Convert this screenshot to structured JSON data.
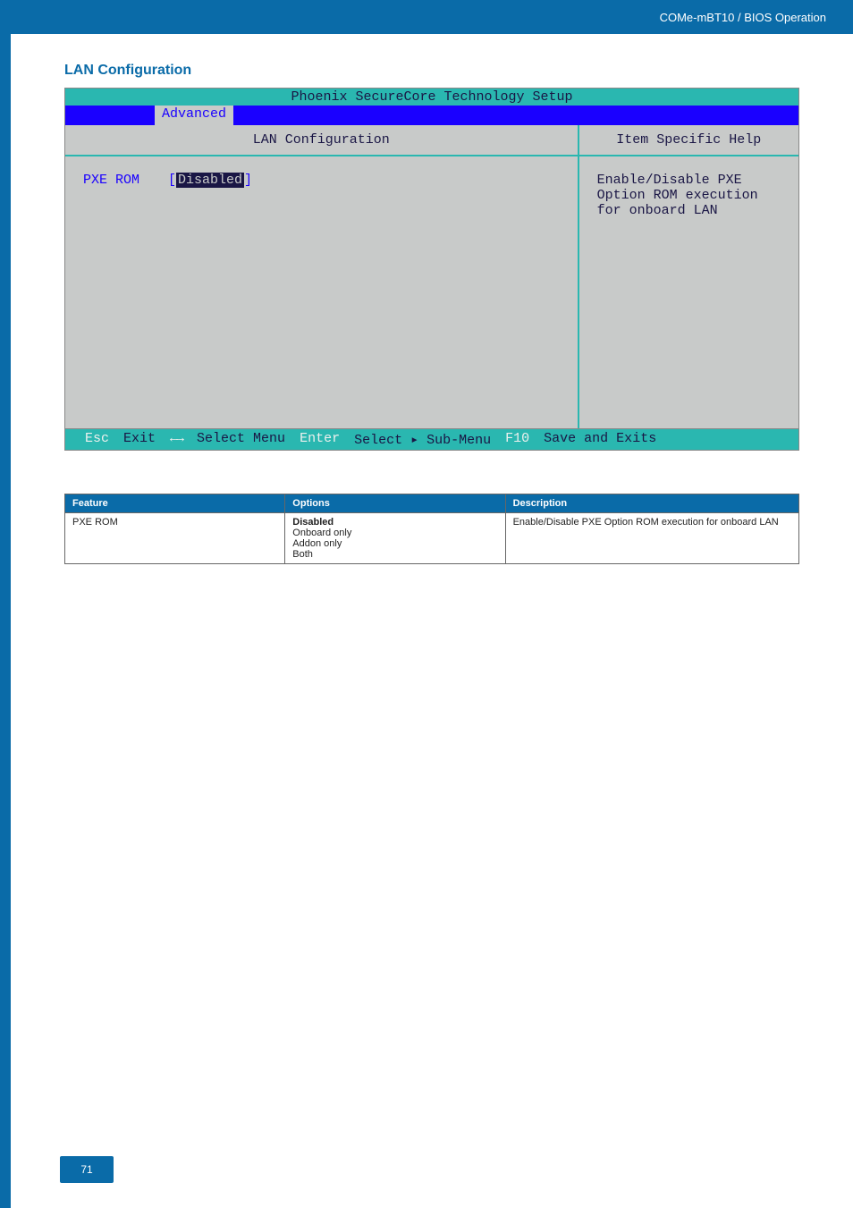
{
  "header": {
    "title_right": "COMe-mBT10 / BIOS Operation"
  },
  "section": {
    "title": "LAN Configuration"
  },
  "bios": {
    "title": "Phoenix SecureCore Technology Setup",
    "active_tab": "Advanced",
    "left_header": "LAN Configuration",
    "right_header": "Item Specific Help",
    "pxe_label": "PXE ROM",
    "pxe_value": "Disabled",
    "help_line1": "Enable/Disable PXE",
    "help_line2": "Option ROM execution",
    "help_line3": "for onboard LAN",
    "footer": {
      "k1": "Esc",
      "v1": "Exit",
      "k2": "←→",
      "v2": "Select Menu",
      "k3": "Enter",
      "v3": "Select ▸ Sub-Menu",
      "k4": "F10",
      "v4": "Save and Exits"
    }
  },
  "table": {
    "headers": {
      "c1": "Feature",
      "c2": "Options",
      "c3": "Description"
    },
    "row1": {
      "feature": "PXE ROM",
      "opt1": "Disabled",
      "opt2": "Onboard only",
      "opt3": "Addon only",
      "opt4": "Both",
      "desc": "Enable/Disable PXE Option ROM execution for onboard LAN"
    }
  },
  "page_number": "71"
}
